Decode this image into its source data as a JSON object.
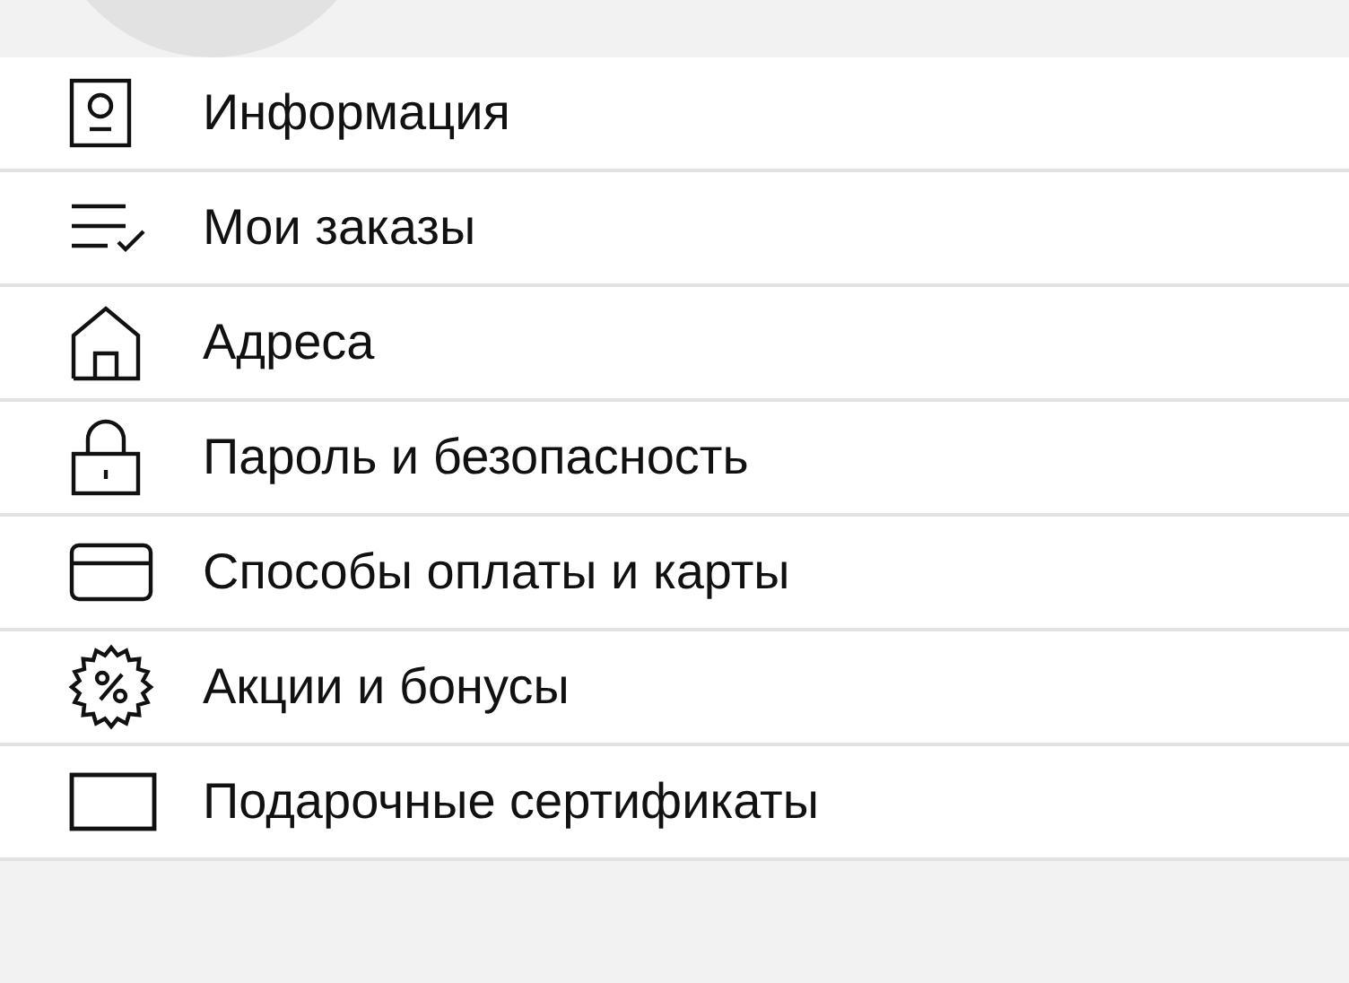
{
  "menu": {
    "items": [
      {
        "kind": "profile",
        "label": "Информация"
      },
      {
        "kind": "orders",
        "label": "Мои заказы"
      },
      {
        "kind": "address",
        "label": "Адреса"
      },
      {
        "kind": "lock",
        "label": "Пароль и безопасность"
      },
      {
        "kind": "card",
        "label": "Способы оплаты и карты"
      },
      {
        "kind": "promo",
        "label": "Акции и бонусы"
      },
      {
        "kind": "gift",
        "label": "Подарочные сертификаты"
      }
    ]
  }
}
